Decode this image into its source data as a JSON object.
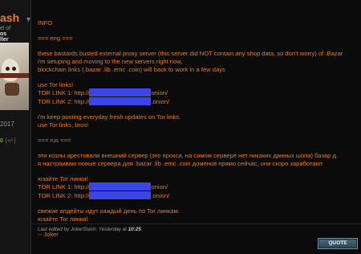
{
  "sidebar": {
    "username": "ash",
    "caret": "▼",
    "subline1": "el of",
    "subline2": "os",
    "subline3": "ller",
    "joined": "2017",
    "rep_plus": "0",
    "rep_controls": "[+/-]"
  },
  "post": {
    "heading": "INFO",
    "eng_marker": "=== eng ===",
    "eng_line1": "these bastards busted external proxy server (this server did NOT contain any shop data, so don't worry) of .Bazar",
    "eng_line2": "i'm setuping and moving to the new servers right now,",
    "eng_line3": "blockchain links (.bazar .lib .emc .coin) will back to work in a few days",
    "eng_tor_heading": "use Tor links!",
    "tor1_label": "TOR LINK 1: http://",
    "tor1_suffix": "onion/",
    "tor2_label": "TOR LINK 2: http://",
    "tor2_suffix": ".onion/",
    "eng_update1": "i'm keep posting everyday fresh updates on Tor links.",
    "eng_update2": "use Tor links, bros!",
    "rus_marker": "=== rus ===",
    "rus_line1": "эти козлы арестовали внешний сервер (это прокси, на самом сервере нет никаких данных шопа) базар д",
    "rus_line2": "я настраиваю новые сервера для .bazar .lib .emc .coin доменов прямо сейчас, они скоро заработают",
    "rus_tor_heading": "юзайте Tor линки!",
    "rtor1_label": "TOR LINK 1: http://",
    "rtor1_suffix": "onion/",
    "rtor2_label": "TOR LINK 2: http://",
    "rtor2_suffix": ".onion/",
    "rus_update1": "свежие апдейты идут каждый день по Tor линкам.",
    "rus_update2": "юзайте Tor линки!",
    "signature": "-- Joker"
  },
  "edit_note": {
    "prefix": "Last edited by JokerStash; Yesterday at ",
    "time": "10:25",
    "suffix": "."
  },
  "quote_button": "QUOTE",
  "colors": {
    "accent": "#e87b1e",
    "redaction": "#3a46e6",
    "background": "#0b0b0b"
  }
}
